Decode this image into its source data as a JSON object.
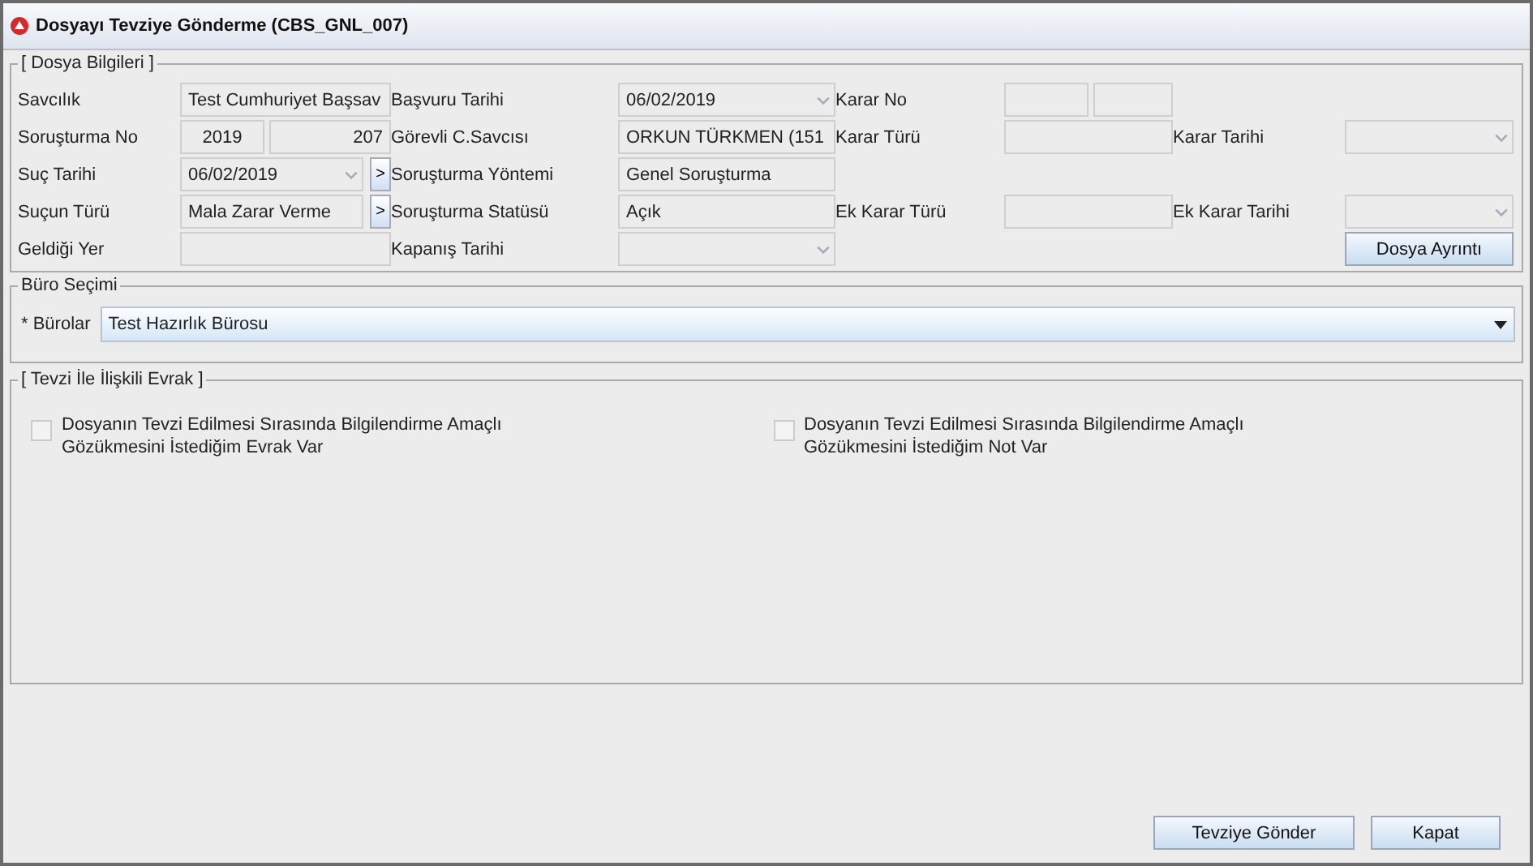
{
  "window": {
    "title": "Dosyayı Tevziye Gönderme (CBS_GNL_007)"
  },
  "dosya_bilgileri": {
    "title": "[ Dosya Bilgileri ]",
    "rows": [
      [
        {
          "kind": "label",
          "text": "Savcılık"
        },
        {
          "kind": "text",
          "text": "Test Cumhuriyet Başsav"
        },
        {
          "kind": "label",
          "text": "Başvuru Tarihi"
        },
        {
          "kind": "combo",
          "text": "06/02/2019"
        },
        {
          "kind": "label",
          "text": "Karar No"
        },
        {
          "kind": "pair"
        },
        {
          "kind": "gap"
        },
        {
          "kind": "gap"
        }
      ],
      [
        {
          "kind": "label",
          "text": "Soruşturma No"
        },
        {
          "kind": "pair",
          "texts": [
            "2019",
            "207"
          ]
        },
        {
          "kind": "label",
          "text": "Görevli C.Savcısı"
        },
        {
          "kind": "text",
          "text": "ORKUN TÜRKMEN (151"
        },
        {
          "kind": "label",
          "text": "Karar Türü"
        },
        {
          "kind": "text"
        },
        {
          "kind": "label",
          "text": "Karar Tarihi"
        },
        {
          "kind": "combo"
        }
      ],
      [
        {
          "kind": "label",
          "text": "Suç Tarihi"
        },
        {
          "kind": "combo_more",
          "text": "06/02/2019",
          "button": ">"
        },
        {
          "kind": "label",
          "text": "Soruşturma Yöntemi"
        },
        {
          "kind": "text",
          "text": "Genel Soruşturma"
        },
        {
          "kind": "gap"
        },
        {
          "kind": "gap"
        },
        {
          "kind": "gap"
        },
        {
          "kind": "gap"
        }
      ],
      [
        {
          "kind": "label",
          "text": "Suçun Türü"
        },
        {
          "kind": "text_more",
          "text": "Mala Zarar Verme",
          "button": ">"
        },
        {
          "kind": "label",
          "text": "Soruşturma Statüsü"
        },
        {
          "kind": "text",
          "text": "Açık"
        },
        {
          "kind": "label",
          "text": "Ek Karar Türü"
        },
        {
          "kind": "text"
        },
        {
          "kind": "label",
          "text": "Ek Karar Tarihi"
        },
        {
          "kind": "combo"
        }
      ],
      [
        {
          "kind": "label",
          "text": "Geldiği Yer"
        },
        {
          "kind": "text"
        },
        {
          "kind": "label",
          "text": "Kapanış Tarihi"
        },
        {
          "kind": "combo"
        },
        {
          "kind": "gap"
        },
        {
          "kind": "gap"
        },
        {
          "kind": "gap"
        },
        {
          "kind": "button",
          "text": "Dosya Ayrıntı"
        }
      ]
    ]
  },
  "buro_secimi": {
    "title": "Büro Seçimi",
    "label": "* Bürolar",
    "value": "Test Hazırlık Bürosu"
  },
  "tevzi_evrak": {
    "title": "[ Tevzi İle İlişkili Evrak ]",
    "options": [
      {
        "label": "Dosyanın Tevzi Edilmesi Sırasında Bilgilendirme Amaçlı Gözükmesini İstediğim Evrak Var",
        "checked": false
      },
      {
        "label": "Dosyanın Tevzi Edilmesi Sırasında Bilgilendirme Amaçlı Gözükmesini İstediğim Not Var",
        "checked": false
      }
    ]
  },
  "buttons": [
    "Tevziye Gönder",
    "Kapat"
  ]
}
